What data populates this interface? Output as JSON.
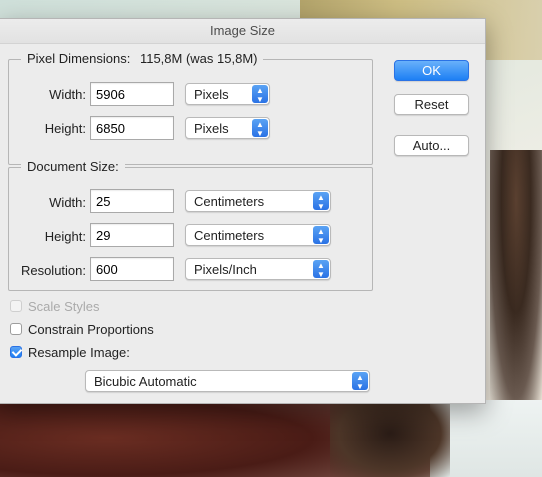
{
  "window": {
    "title": "Image Size"
  },
  "pixel_dimensions": {
    "label": "Pixel Dimensions:",
    "size_text": "115,8M (was 15,8M)",
    "width": {
      "label": "Width:",
      "value": "5906",
      "unit": "Pixels"
    },
    "height": {
      "label": "Height:",
      "value": "6850",
      "unit": "Pixels"
    }
  },
  "document_size": {
    "label": "Document Size:",
    "width": {
      "label": "Width:",
      "value": "25",
      "unit": "Centimeters"
    },
    "height": {
      "label": "Height:",
      "value": "29",
      "unit": "Centimeters"
    },
    "resolution": {
      "label": "Resolution:",
      "value": "600",
      "unit": "Pixels/Inch"
    }
  },
  "options": {
    "scale_styles": {
      "label": "Scale Styles",
      "checked": false,
      "enabled": false
    },
    "constrain_proportions": {
      "label": "Constrain Proportions",
      "checked": false,
      "enabled": true
    },
    "resample_image": {
      "label": "Resample Image:",
      "checked": true,
      "enabled": true
    },
    "resample_method": "Bicubic Automatic"
  },
  "buttons": {
    "ok": "OK",
    "reset": "Reset",
    "auto": "Auto..."
  },
  "colors": {
    "accent": "#1d7ff4",
    "dialog_bg": "#ececec"
  }
}
